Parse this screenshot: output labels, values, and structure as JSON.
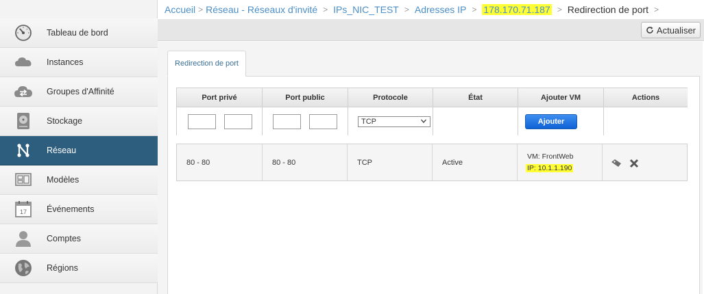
{
  "sidebar": {
    "items": [
      {
        "label": "Tableau de bord",
        "icon": "dashboard-gauge-icon"
      },
      {
        "label": "Instances",
        "icon": "cloud-icon"
      },
      {
        "label": "Groupes d'Affinité",
        "icon": "cloud-arrows-icon"
      },
      {
        "label": "Stockage",
        "icon": "hard-drive-icon"
      },
      {
        "label": "Réseau",
        "icon": "network-icon",
        "active": true
      },
      {
        "label": "Modèles",
        "icon": "templates-icon"
      },
      {
        "label": "Événements",
        "icon": "calendar-icon",
        "day": "17"
      },
      {
        "label": "Comptes",
        "icon": "user-icon"
      },
      {
        "label": "Régions",
        "icon": "globe-icon"
      }
    ]
  },
  "breadcrumb": {
    "items": [
      "Accueil",
      "Réseau - Réseaux d'invité",
      "IPs_NIC_TEST",
      "Adresses IP",
      "178.170.71.187",
      "Redirection de port"
    ],
    "separator": ">"
  },
  "toolbar": {
    "refresh_label": "Actualiser"
  },
  "tab": {
    "label": "Redirection de port"
  },
  "table": {
    "headers": [
      "Port privé",
      "Port public",
      "Protocole",
      "État",
      "Ajouter VM",
      "Actions"
    ],
    "protocol_selected": "TCP",
    "add_button_label": "Ajouter"
  },
  "rule": {
    "private_port": "80 - 80",
    "public_port": "80 - 80",
    "protocol": "TCP",
    "state": "Active",
    "vm_name": "VM: FrontWeb",
    "vm_ip": "IP: 10.1.1.190"
  },
  "colors": {
    "highlight": "#ffff33",
    "active_nav": "#2e5e7e",
    "link": "#4a8ec9",
    "button": "#0f62d6"
  }
}
